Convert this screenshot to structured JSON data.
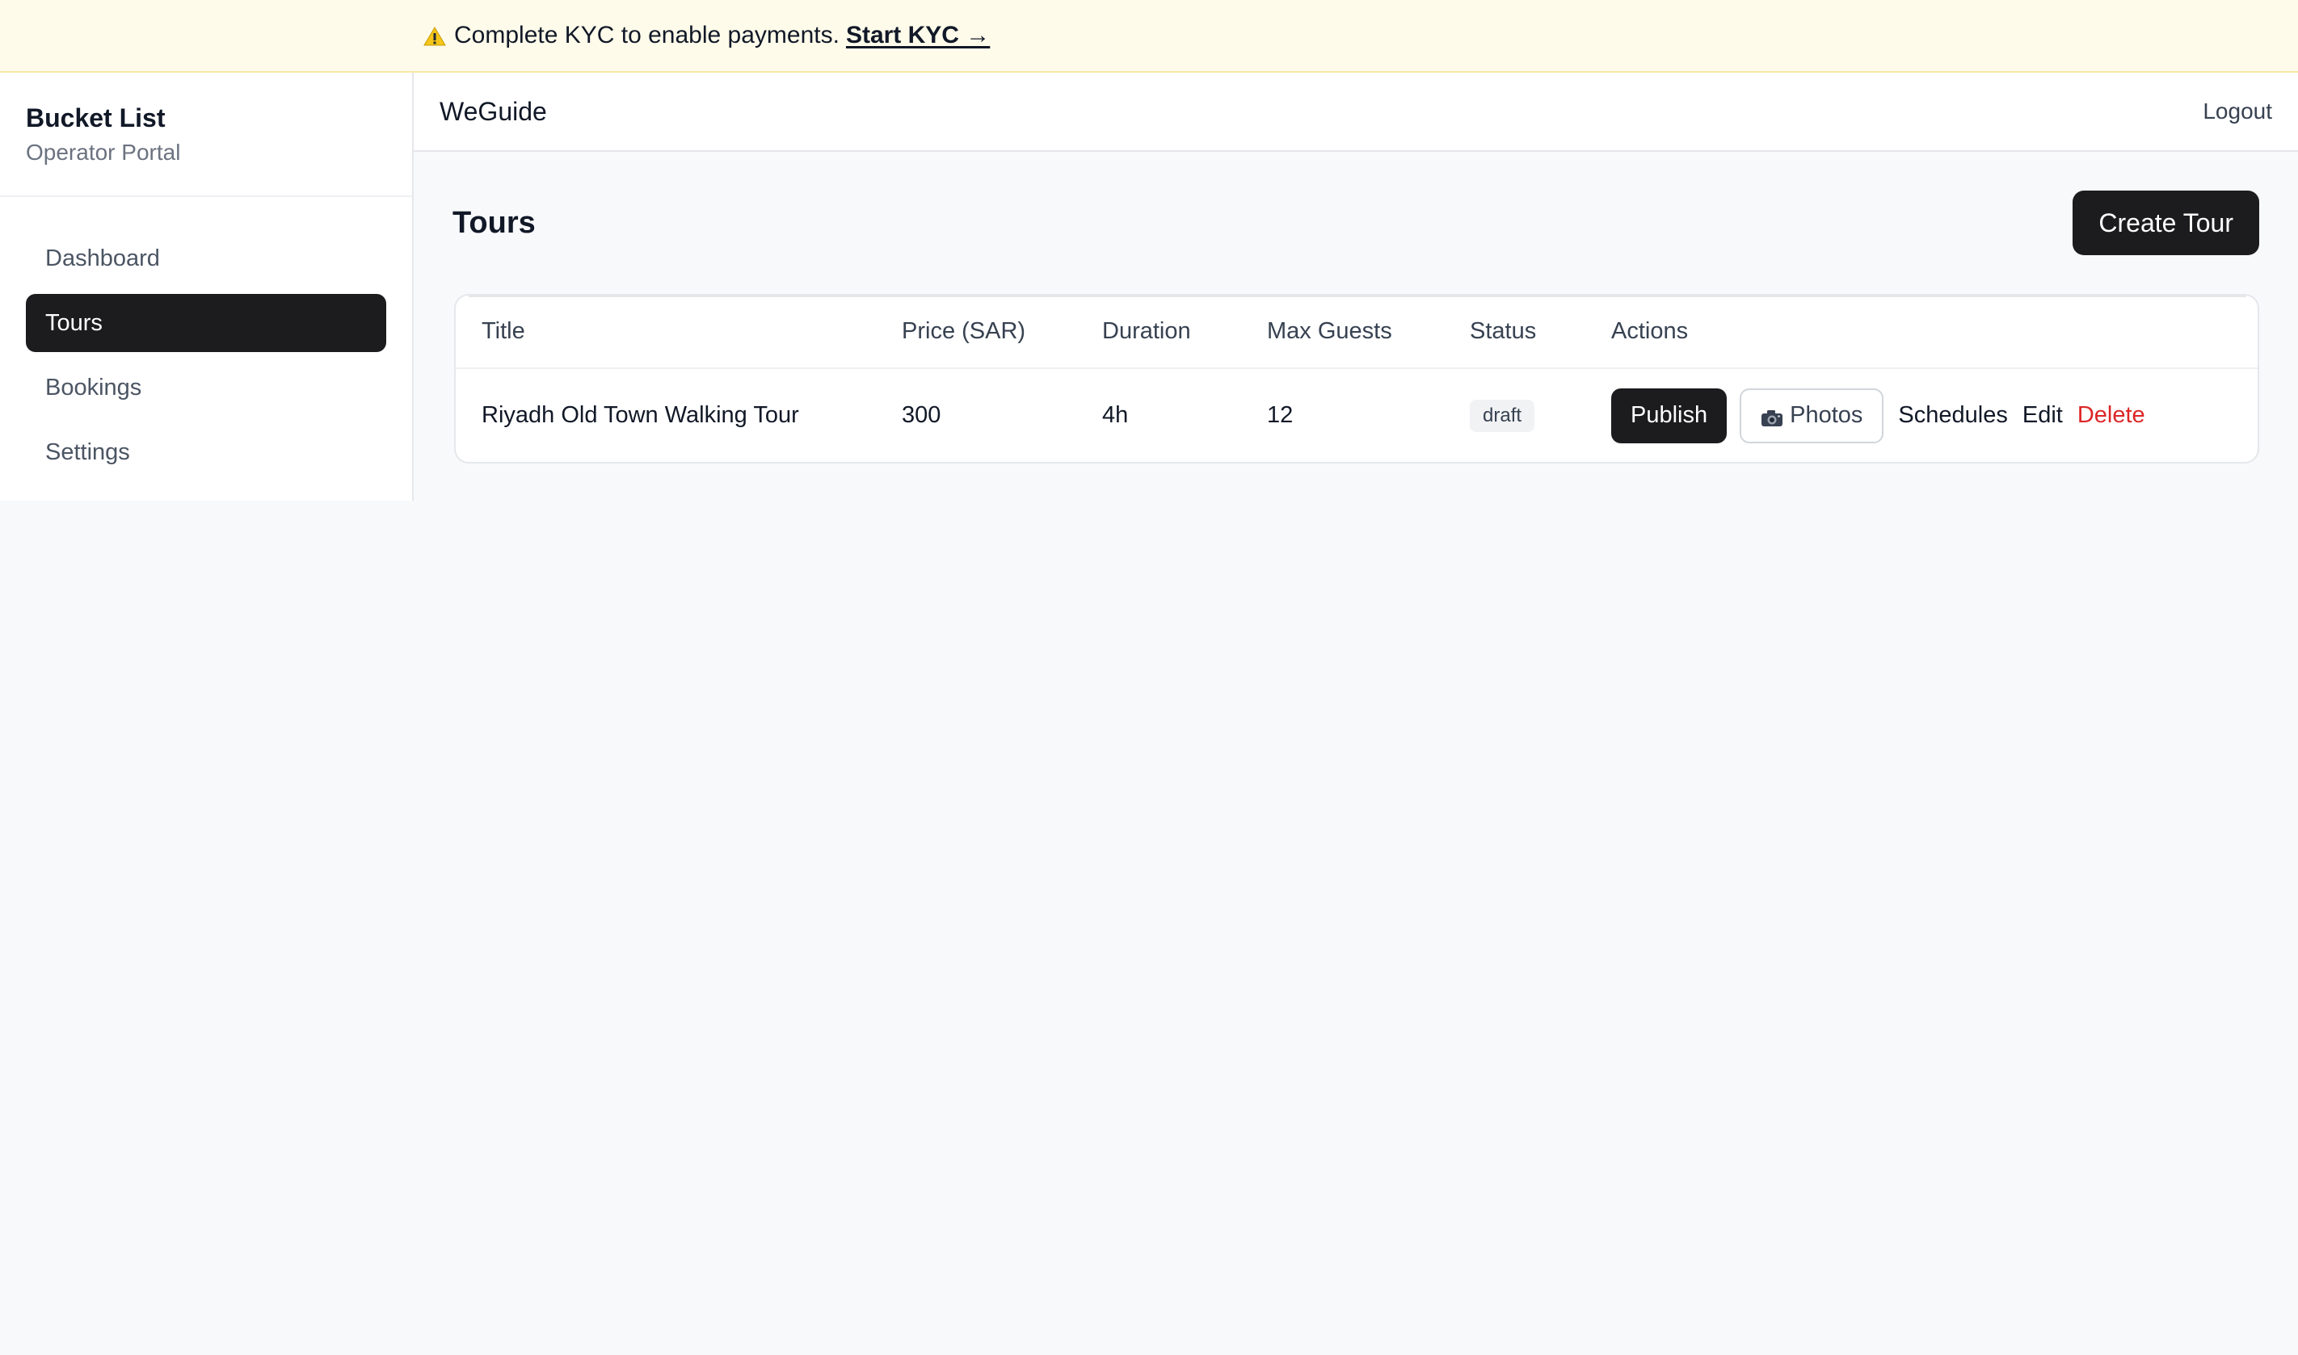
{
  "banner": {
    "icon": "warning-icon",
    "text": "Complete KYC to enable payments.",
    "link_label": "Start KYC →",
    "background": "#fefbea"
  },
  "sidebar": {
    "brand_title": "Bucket List",
    "brand_subtitle": "Operator Portal",
    "items": [
      {
        "label": "Dashboard",
        "active": false
      },
      {
        "label": "Tours",
        "active": true
      },
      {
        "label": "Bookings",
        "active": false
      },
      {
        "label": "Settings",
        "active": false
      }
    ]
  },
  "header": {
    "app_name": "WeGuide",
    "logout_label": "Logout"
  },
  "main": {
    "page_title": "Tours",
    "create_button_label": "Create Tour",
    "table": {
      "columns": [
        "Title",
        "Price (SAR)",
        "Duration",
        "Max Guests",
        "Status",
        "Actions"
      ],
      "rows": [
        {
          "title": "Riyadh Old Town Walking Tour",
          "price": "300",
          "duration": "4h",
          "max_guests": "12",
          "status": "draft",
          "actions": {
            "publish": "Publish",
            "photos": "Photos",
            "photos_icon": "camera-icon",
            "schedules": "Schedules",
            "edit": "Edit",
            "delete": "Delete"
          }
        }
      ]
    }
  },
  "colors": {
    "primary_dark": "#1c1c1e",
    "danger": "#dc2626",
    "page_background": "#f8f9fb"
  }
}
